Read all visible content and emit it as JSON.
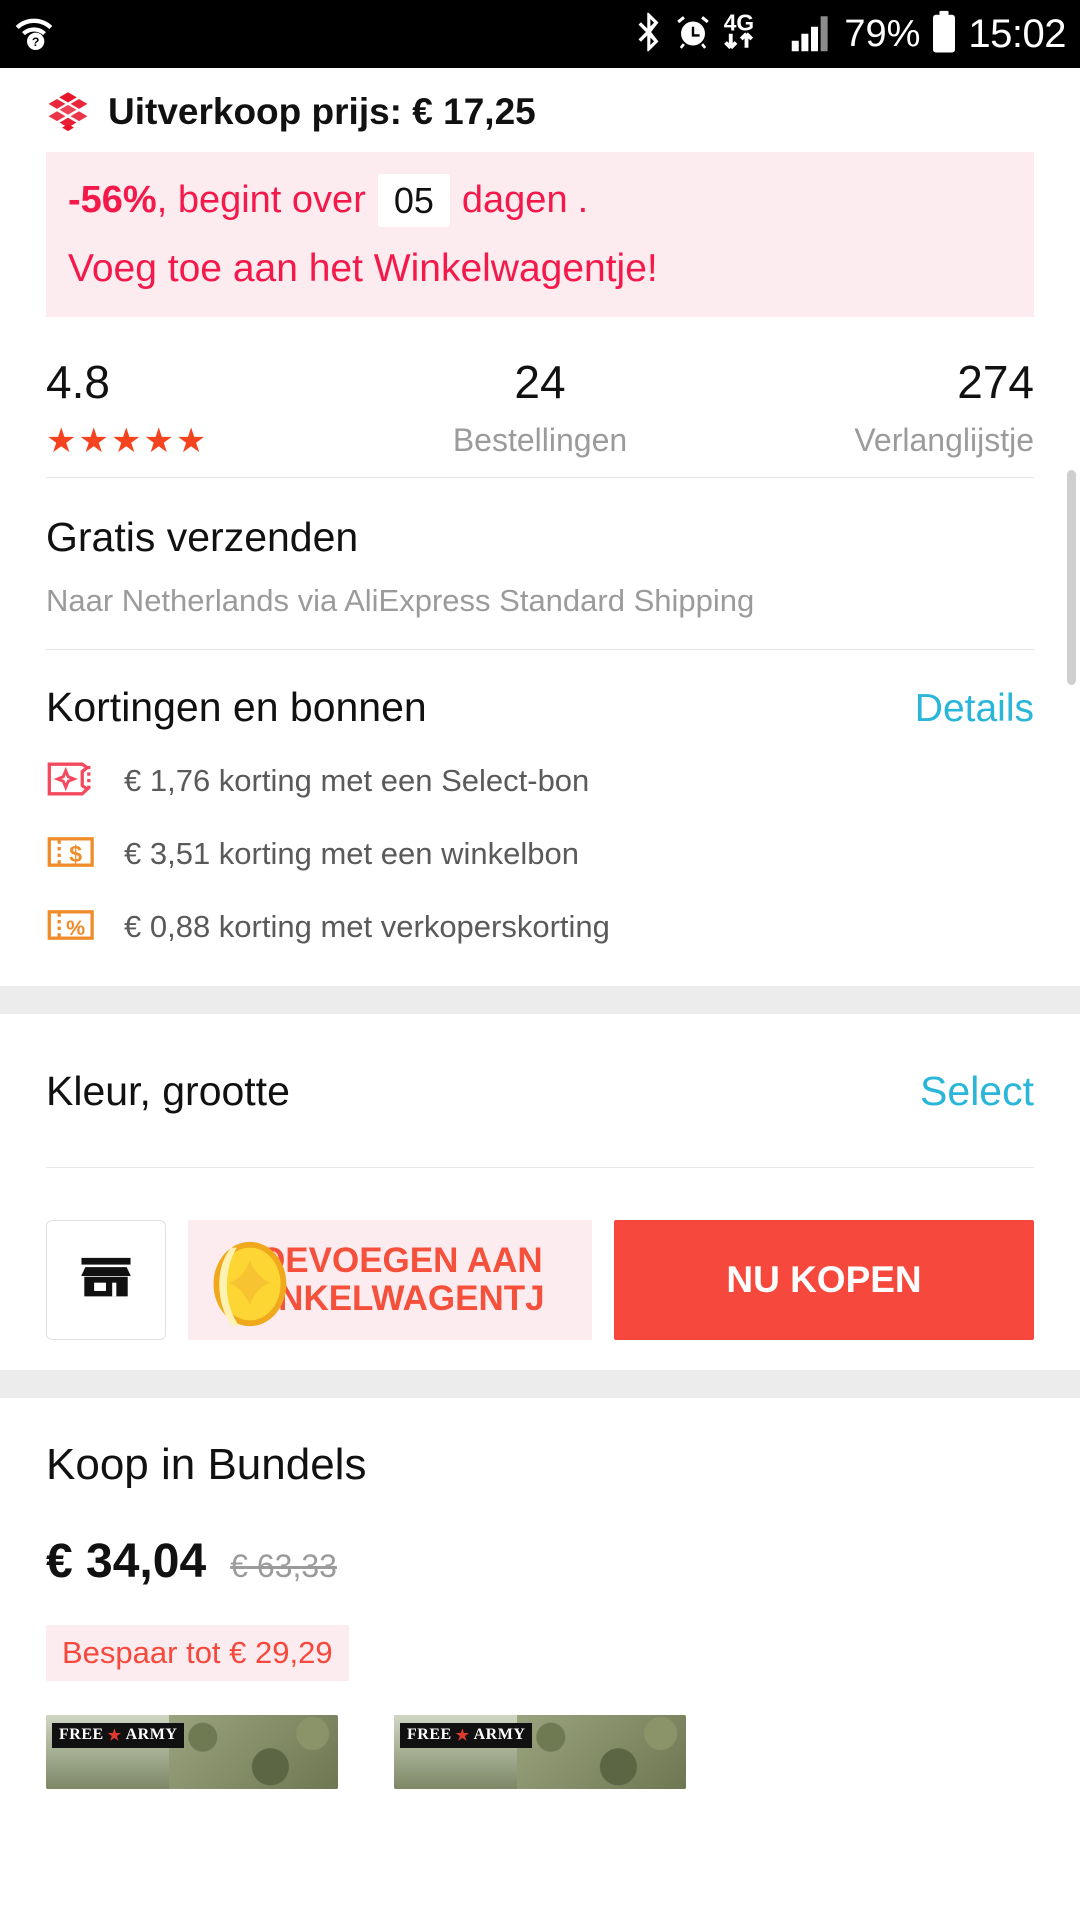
{
  "statusbar": {
    "wifi_icon": "wifi-question-icon",
    "bluetooth_icon": "bluetooth-icon",
    "alarm_icon": "alarm-clock-icon",
    "network_label": "4G",
    "data_icon": "data-transfer-icon",
    "signal_icon": "signal-bars-icon",
    "battery_percent": "79%",
    "battery_icon": "battery-icon",
    "time": "15:02"
  },
  "sale": {
    "icon": "cube-icon",
    "heading": "Uitverkoop prijs: € 17,25",
    "discount": "-56%",
    "mid_text": ", begint over",
    "days_value": "05",
    "days_unit": "dagen",
    "period": ".",
    "cta": "Voeg toe aan het Winkelwagentje!",
    "accent": "#f4194b",
    "bg": "#fdecef"
  },
  "stats": [
    {
      "value": "4.8",
      "label": "",
      "stars": "★★★★★",
      "name": "rating"
    },
    {
      "value": "24",
      "label": "Bestellingen",
      "stars": "",
      "name": "orders"
    },
    {
      "value": "274",
      "label": "Verlanglijstje",
      "stars": "",
      "name": "wishlist"
    }
  ],
  "shipping": {
    "title": "Gratis verzenden",
    "subtitle": "Naar Netherlands via AliExpress Standard Shipping"
  },
  "coupons": {
    "title": "Kortingen en bonnen",
    "details_label": "Details",
    "details_color": "#29b6d8",
    "items": [
      {
        "icon": "coupon-sparkle-icon",
        "color": "#f4495c",
        "glyph": "✦",
        "text": "€ 1,76 korting met een Select-bon"
      },
      {
        "icon": "coupon-dollar-icon",
        "color": "#f08b2a",
        "glyph": "$",
        "text": "€ 3,51 korting met een winkelbon"
      },
      {
        "icon": "coupon-percent-icon",
        "color": "#f08b2a",
        "glyph": "%",
        "text": "€ 0,88 korting met verkoperskorting"
      }
    ]
  },
  "variant": {
    "title": "Kleur, grootte",
    "action_label": "Select",
    "action_color": "#29b6d8"
  },
  "actions": {
    "store_icon": "storefront-icon",
    "coin_icon": "gold-coin-icon",
    "cart_label": "TOEVOEGEN AAN WINKELWAGENTJ",
    "cart_color": "#f4503c",
    "cart_bg": "#fdecef",
    "buy_label": "NU KOPEN",
    "buy_bg": "#f6483c"
  },
  "bundles": {
    "title": "Koop in Bundels",
    "price": "€ 34,04",
    "old_price": "€ 63,33",
    "save_label": "Bespaar tot € 29,29",
    "save_color": "#f6483c",
    "thumbnails": [
      {
        "badge": "FREE",
        "badge_star": "★",
        "badge_end": "ARMY",
        "name": "bundle-thumbnail-1"
      },
      {
        "badge": "FREE",
        "badge_star": "★",
        "badge_end": "ARMY",
        "name": "bundle-thumbnail-2"
      }
    ]
  }
}
